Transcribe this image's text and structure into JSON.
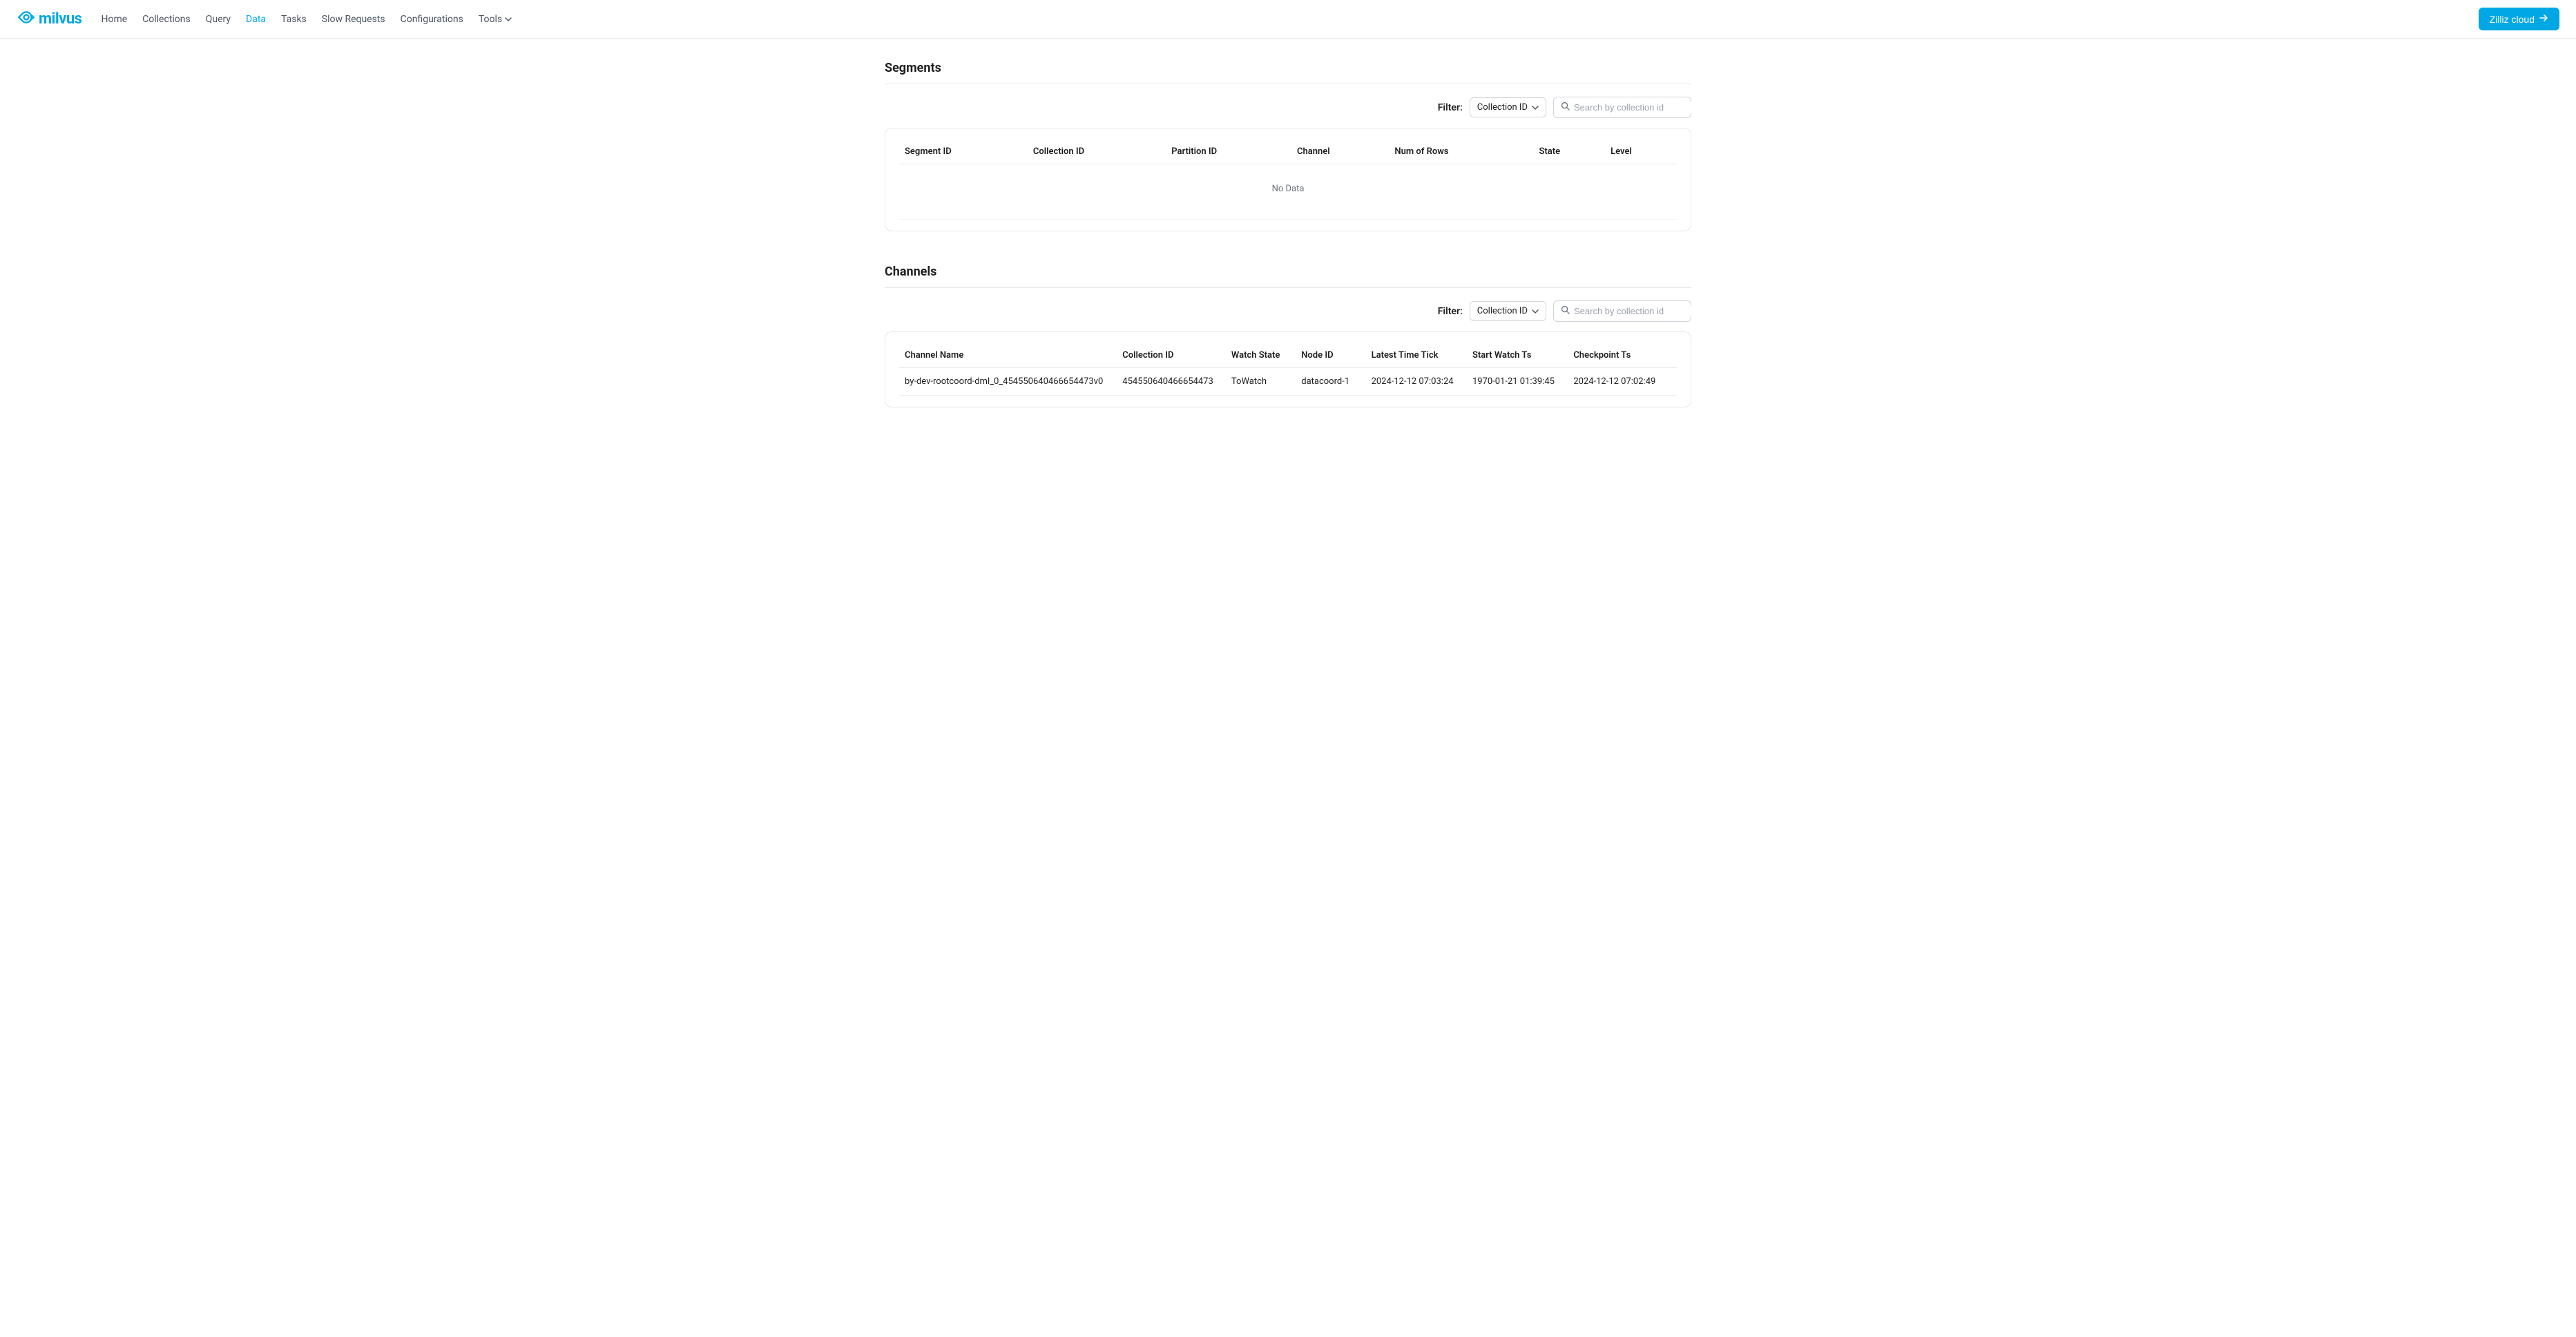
{
  "app": {
    "brand": "milvus",
    "cloud_button": "Zilliz cloud"
  },
  "nav": {
    "items": [
      {
        "label": "Home",
        "active": false
      },
      {
        "label": "Collections",
        "active": false
      },
      {
        "label": "Query",
        "active": false
      },
      {
        "label": "Data",
        "active": true
      },
      {
        "label": "Tasks",
        "active": false
      },
      {
        "label": "Slow Requests",
        "active": false
      },
      {
        "label": "Configurations",
        "active": false
      },
      {
        "label": "Tools",
        "active": false,
        "has_dropdown": true
      }
    ]
  },
  "segments": {
    "title": "Segments",
    "filter_label": "Filter:",
    "filter_option": "Collection ID",
    "search_placeholder": "Search by collection id",
    "columns": [
      "Segment ID",
      "Collection ID",
      "Partition ID",
      "Channel",
      "Num of Rows",
      "State",
      "Level"
    ],
    "no_data": "No Data"
  },
  "channels": {
    "title": "Channels",
    "filter_label": "Filter:",
    "filter_option": "Collection ID",
    "search_placeholder": "Search by collection id",
    "columns": [
      "Channel Name",
      "Collection ID",
      "Watch State",
      "Node ID",
      "Latest Time Tick",
      "Start Watch Ts",
      "Checkpoint Ts"
    ],
    "rows": [
      {
        "channel_name": "by-dev-rootcoord-dml_0_454550640466654473v0",
        "collection_id": "454550640466654473",
        "watch_state": "ToWatch",
        "node_id": "datacoord-1",
        "latest_time_tick": "2024-12-12 07:03:24",
        "start_watch_ts": "1970-01-21 01:39:45",
        "checkpoint_ts": "2024-12-12 07:02:49"
      }
    ]
  }
}
